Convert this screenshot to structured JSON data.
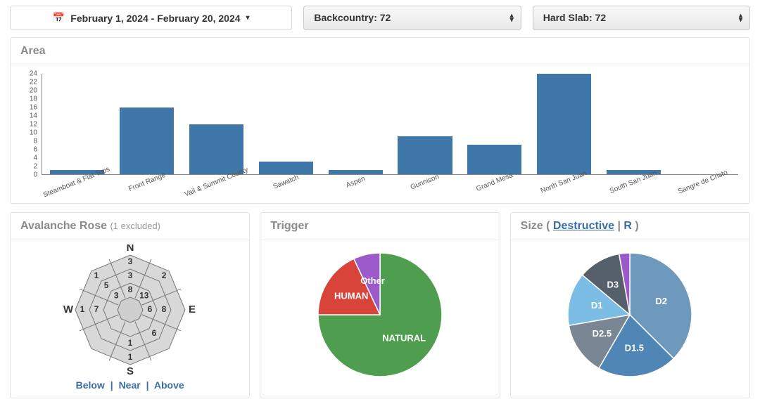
{
  "controls": {
    "date_range": "February 1, 2024 - February 20, 2024",
    "select_a": "Backcountry: 72",
    "select_b": "Hard Slab: 72"
  },
  "area_panel": {
    "title": "Area"
  },
  "rose_panel": {
    "title": "Avalanche Rose",
    "subtitle": "(1 excluded)",
    "links": {
      "below": "Below",
      "near": "Near",
      "above": "Above"
    },
    "compass": {
      "n": "N",
      "e": "E",
      "s": "S",
      "w": "W"
    },
    "rose_values": {
      "outer": {
        "N": 3,
        "NE": 2,
        "E": null,
        "SE": null,
        "S": 1,
        "SW": null,
        "W": 1,
        "NW": 1
      },
      "middle": {
        "N": 3,
        "NE": null,
        "E": 8,
        "SE": 6,
        "S": 1,
        "SW": null,
        "W": 7,
        "NW": 5
      },
      "inner": {
        "N": 8,
        "NE": 13,
        "E": 6,
        "SE": null,
        "S": null,
        "SW": null,
        "W": null,
        "NW": 3
      }
    }
  },
  "trigger_panel": {
    "title": "Trigger",
    "labels": {
      "human": "HUMAN",
      "natural": "NATURAL"
    }
  },
  "size_panel": {
    "title_prefix": "Size ( ",
    "link_destructive": "Destructive",
    "link_r": "R",
    "title_suffix": " )"
  },
  "chart_data": [
    {
      "type": "bar",
      "title": "Area",
      "categories": [
        "Steamboat & Flat Tops",
        "Front Range",
        "Vail & Summit County",
        "Sawatch",
        "Aspen",
        "Gunnison",
        "Grand Mesa",
        "North San Juan",
        "South San Juan",
        "Sangre de Cristo"
      ],
      "values": [
        1,
        16,
        12,
        3,
        1,
        9,
        7,
        24,
        1,
        0
      ],
      "ylim": [
        0,
        24
      ],
      "yticks": [
        0,
        2,
        4,
        6,
        8,
        10,
        12,
        14,
        16,
        18,
        20,
        22,
        24
      ]
    },
    {
      "type": "pie",
      "title": "Trigger",
      "series": [
        {
          "name": "NATURAL",
          "value": 54,
          "color": "#4f9e4f"
        },
        {
          "name": "HUMAN",
          "value": 13,
          "color": "#d9443a"
        },
        {
          "name": "Other",
          "value": 5,
          "color": "#9b59c9"
        }
      ]
    },
    {
      "type": "pie",
      "title": "Size (Destructive)",
      "series": [
        {
          "name": "D2",
          "value": 27,
          "color": "#6f98bd"
        },
        {
          "name": "D1.5",
          "value": 15,
          "color": "#4f86b5"
        },
        {
          "name": "D2.5",
          "value": 10,
          "color": "#7a8693"
        },
        {
          "name": "D1",
          "value": 10,
          "color": "#7cbde6"
        },
        {
          "name": "D3",
          "value": 8,
          "color": "#55606c"
        },
        {
          "name": "",
          "value": 2,
          "color": "#9b59c9"
        }
      ]
    }
  ]
}
